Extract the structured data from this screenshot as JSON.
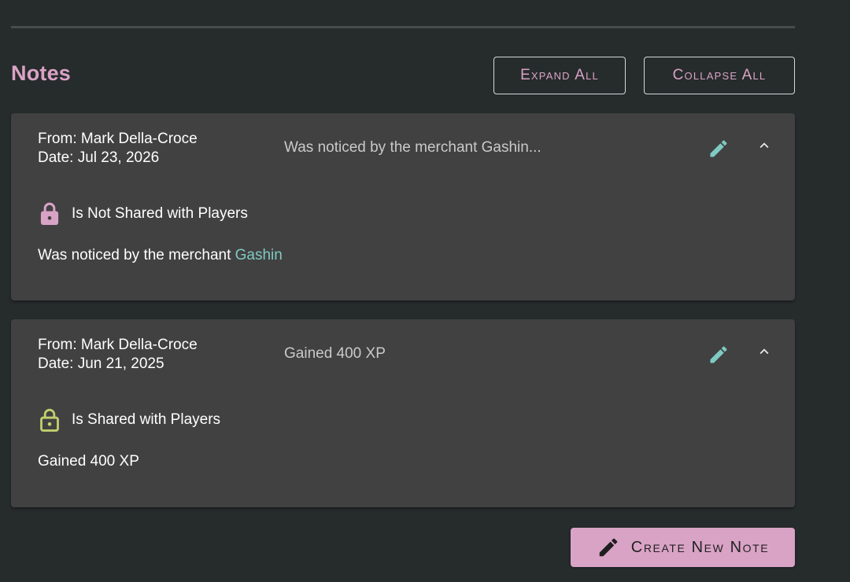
{
  "header": {
    "title": "Notes",
    "expand_all_label": "Expand All",
    "collapse_all_label": "Collapse All"
  },
  "notes": [
    {
      "from": "From: Mark Della-Croce",
      "date": "Date: Jul 23, 2026",
      "summary": "Was noticed by the merchant Gashin...",
      "share_status": "Is Not Shared with Players",
      "shared": false,
      "lock_icon": "lock-closed-icon",
      "body_text": "Was noticed by the merchant ",
      "body_link": "Gashin"
    },
    {
      "from": "From: Mark Della-Croce",
      "date": "Date: Jun 21, 2025",
      "summary": "Gained 400 XP",
      "share_status": "Is Shared with Players",
      "shared": true,
      "lock_icon": "lock-open-icon",
      "body_text": "Gained 400 XP"
    }
  ],
  "footer": {
    "create_label": "Create New Note",
    "create_icon": "pencil-icon"
  },
  "colors": {
    "background": "#262b2c",
    "card": "#414141",
    "accent_pink": "#d9a3c6",
    "accent_teal": "#7fcac3",
    "shared_green": "#c2cf6e"
  }
}
